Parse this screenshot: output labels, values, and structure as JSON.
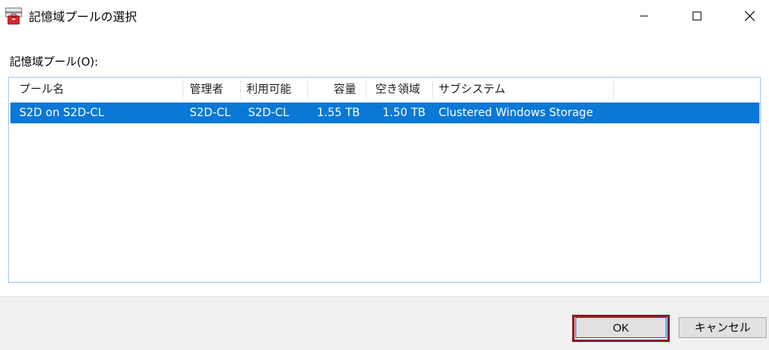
{
  "window": {
    "title": "記憶域プールの選択",
    "controls": {
      "minimize": "minimize-icon",
      "maximize": "maximize-icon",
      "close": "close-icon"
    }
  },
  "pool_list": {
    "label": "記憶域プール(O):",
    "columns": [
      "プール名",
      "管理者",
      "利用可能",
      "容量",
      "空き領域",
      "サブシステム"
    ],
    "rows": [
      {
        "name": "S2D on S2D-CL",
        "manager": "S2D-CL",
        "available": "S2D-CL",
        "capacity": "1.55 TB",
        "free": "1.50 TB",
        "subsystem": "Clustered Windows Storage",
        "selected": true
      }
    ]
  },
  "buttons": {
    "ok": "OK",
    "cancel": "キャンセル"
  },
  "colors": {
    "selection": "#0a78d7",
    "highlight_border": "#8b1a2b"
  }
}
